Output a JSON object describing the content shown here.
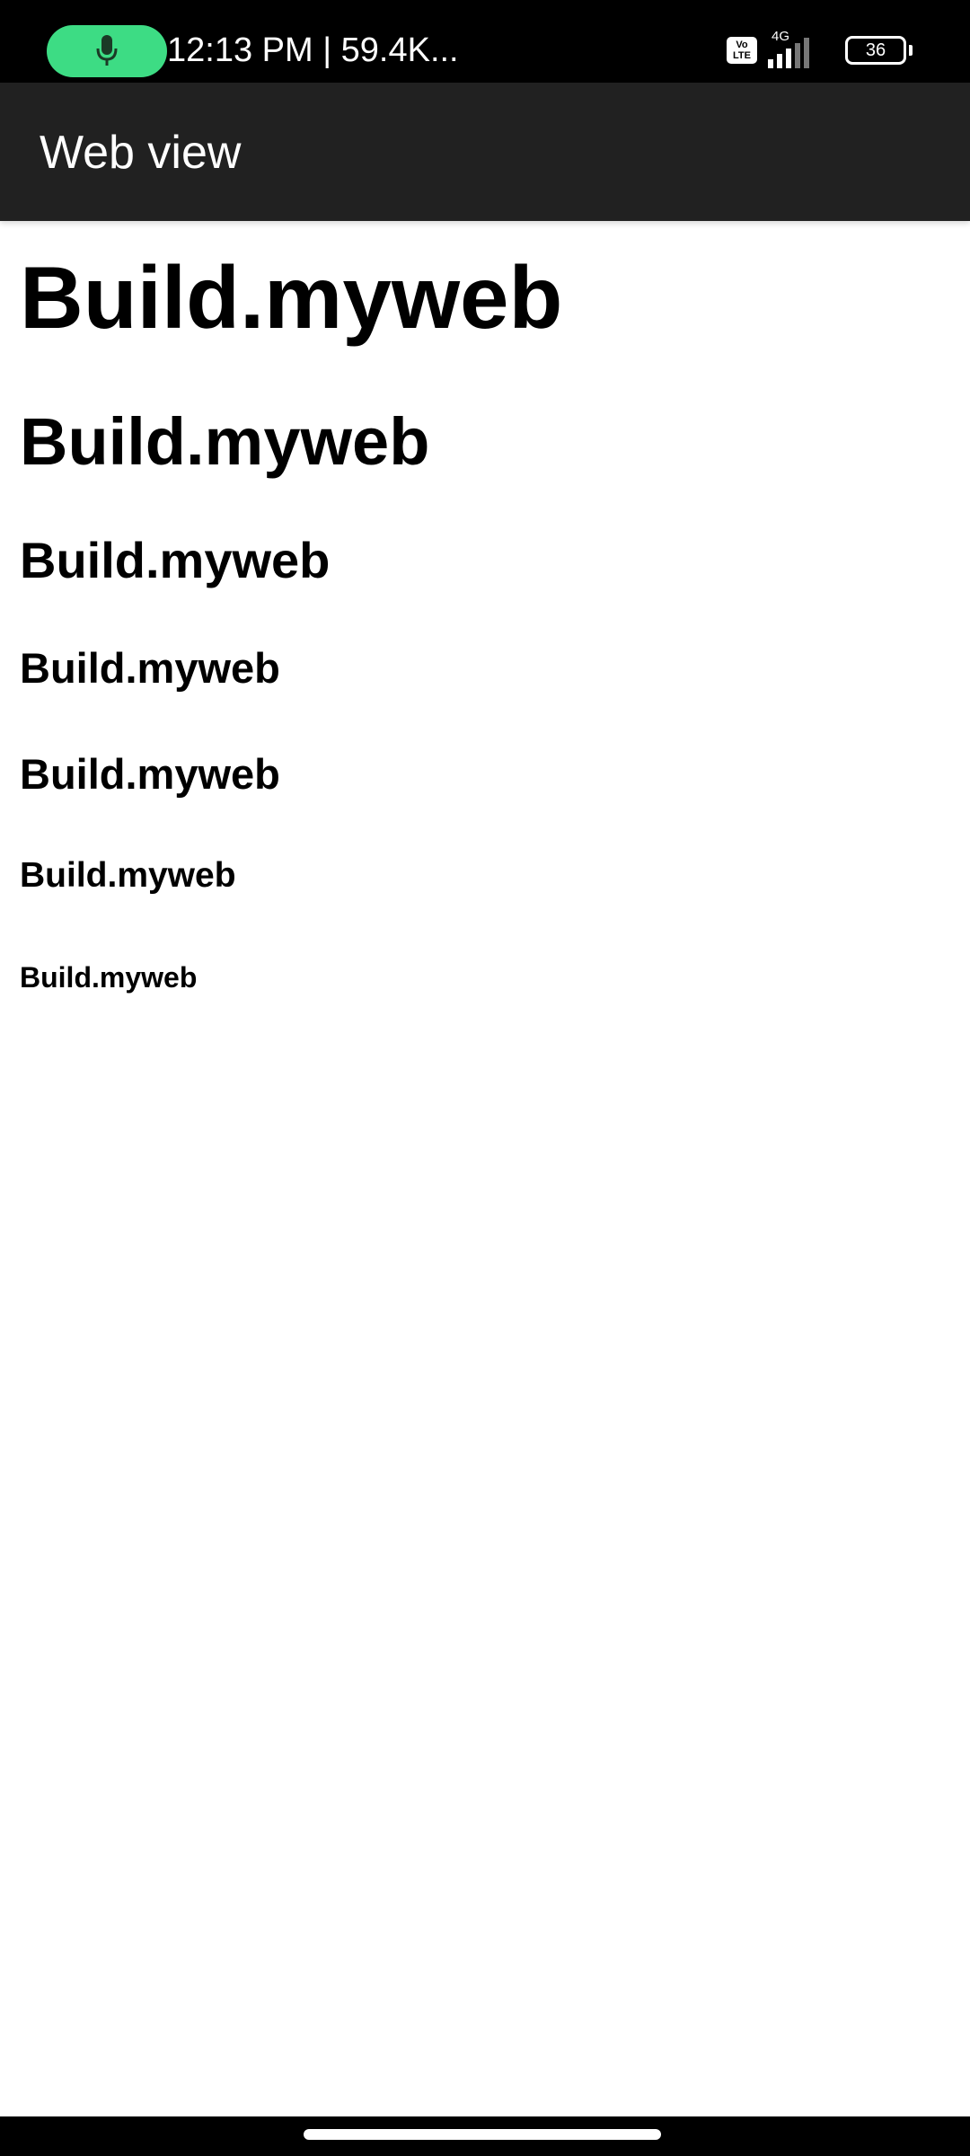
{
  "status_bar": {
    "time_text": "12:13 PM | 59.4K...",
    "volte_line1": "Vo",
    "volte_line2": "LTE",
    "network": "4G",
    "battery": "36",
    "signal_level": 0.6
  },
  "app_bar": {
    "title": "Web view"
  },
  "webview": {
    "headings": [
      "Build.myweb",
      "Build.myweb",
      "Build.myweb",
      "Build.myweb",
      "Build.myweb",
      "Build.myweb",
      "Build.myweb"
    ]
  },
  "colors": {
    "mic_pill": "#3ddc84",
    "app_bar_bg": "#212121",
    "status_bar_bg": "#000000"
  }
}
